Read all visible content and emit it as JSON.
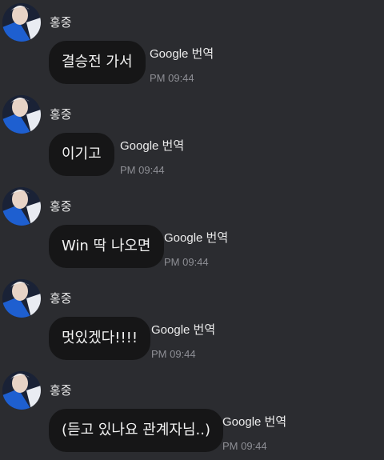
{
  "messages": [
    {
      "sender": "홍중",
      "text": "결승전 가서",
      "translate_label": "Google 번역",
      "time": "PM 09:44",
      "avatar_icon": "profile-photo-icon"
    },
    {
      "sender": "홍중",
      "text": "이기고",
      "translate_label": "Google 번역",
      "time": "PM 09:44",
      "avatar_icon": "profile-photo-icon"
    },
    {
      "sender": "홍중",
      "text": "Win 딱 나오면",
      "translate_label": "Google 번역",
      "time": "PM 09:44",
      "avatar_icon": "profile-photo-icon"
    },
    {
      "sender": "홍중",
      "text": "멋있겠다!!!!",
      "translate_label": "Google 번역",
      "time": "PM 09:44",
      "avatar_icon": "profile-photo-icon"
    },
    {
      "sender": "홍중",
      "text": "(듣고 있나요 관계자님..)",
      "translate_label": "Google 번역",
      "time": "PM 09:44",
      "avatar_icon": "profile-photo-icon"
    }
  ],
  "colors": {
    "background": "#2b2c30",
    "bubble": "#161617",
    "time": "#8e8f95",
    "avatar_accent": "#1e5fd0"
  }
}
